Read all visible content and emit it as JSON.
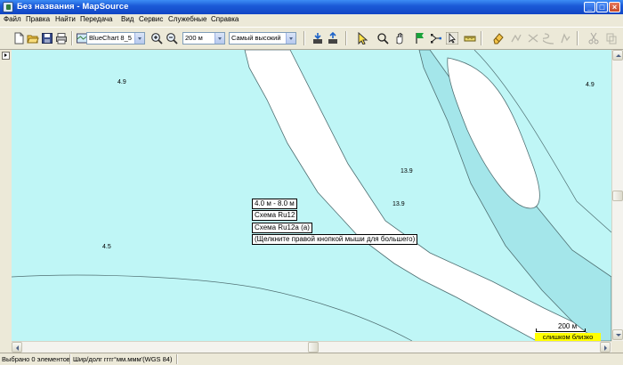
{
  "window": {
    "title": "Без названия - MapSource",
    "controls": {
      "minimize": "_",
      "maximize": "□",
      "close": "×"
    }
  },
  "menu": [
    "Файл",
    "Правка",
    "Найти",
    "Передача",
    "Вид",
    "Сервис",
    "Служебные",
    "Справка"
  ],
  "toolbar": {
    "map_product": "BlueChart 8_5",
    "zoom_scale": "200 м",
    "detail_level": "Самый высокий",
    "icons": [
      "new-file-icon",
      "open-file-icon",
      "save-icon",
      "print-icon",
      "zoom-in-icon",
      "zoom-out-icon",
      "receive-from-device-icon",
      "send-to-device-icon",
      "map-select-icon",
      "zoom-tool-icon",
      "hand-pan-icon",
      "waypoint-flag-icon",
      "route-tool-icon",
      "pointer-icon",
      "measure-tool-icon",
      "eraser-icon",
      "cut-icon"
    ]
  },
  "map": {
    "colors": {
      "water": "#bff6f6",
      "shallow": "#a4e6ea",
      "land": "#ffffff",
      "outline": "#4f6f72"
    },
    "depths": [
      "4.9",
      "4.9",
      "13.9",
      "13.9",
      "4.5"
    ],
    "popup": [
      "4.0 м - 8.0 м",
      "Схема Ru12",
      "Схема Ru12а (а)",
      "(Щелкните правой кнопкой мыши для большего)"
    ],
    "scale_label": "200 м",
    "zoom_warning": "слишком близко",
    "warning_color": "#ffff00"
  },
  "status": {
    "selected": "Выбрано 0 элементов",
    "coord_format": "Шир/долг гггг°мм.ммм'(WGS 84)"
  }
}
